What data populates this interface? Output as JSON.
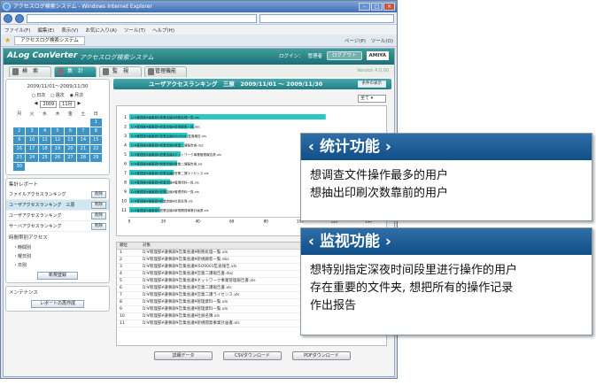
{
  "browser": {
    "title": "アクセスログ検索システム - Windows Internet Explorer",
    "menu": [
      "ファイル(F)",
      "編集(E)",
      "表示(V)",
      "お気に入り(A)",
      "ツール(T)",
      "ヘルプ(H)"
    ],
    "tab": "アクセスログ検索システム",
    "tools": [
      "ページ(P)",
      "ツール(O)"
    ]
  },
  "app": {
    "logo": "ALog ConVerter",
    "subtitle": "アクセスログ検索システム",
    "login_label": "ログイン：",
    "user": "管理者",
    "logout": "ログアウト",
    "vendor": "AMIYA",
    "version": "Version 4.0.00",
    "tabs": [
      "検　索",
      "集　計",
      "監　視",
      "管理機能"
    ]
  },
  "sidebar": {
    "date_range": "2009/11/01〜2009/11/30",
    "radios": [
      "日次",
      "週次",
      "月次"
    ],
    "year": "2009",
    "month": "11月",
    "weekdays": [
      "月",
      "火",
      "水",
      "木",
      "金",
      "土",
      "日"
    ],
    "days": [
      "",
      "",
      "",
      "",
      "",
      "",
      "1",
      "2",
      "3",
      "4",
      "5",
      "6",
      "7",
      "8",
      "9",
      "10",
      "11",
      "12",
      "13",
      "14",
      "15",
      "16",
      "17",
      "18",
      "19",
      "20",
      "21",
      "22",
      "23",
      "24",
      "25",
      "26",
      "27",
      "28",
      "29",
      "30"
    ],
    "report_title": "集計レポート",
    "reports": [
      {
        "label": "ファイルアクセスランキング",
        "btn": "削除"
      },
      {
        "label": "ユーザアクセスランキング　三原",
        "btn": "削除"
      },
      {
        "label": "ユーザアクセスランキング",
        "btn": "削除"
      },
      {
        "label": "サーバアクセスランキング",
        "btn": "削除"
      }
    ],
    "time_title": "時間帯別アクセス",
    "time_items": [
      "・時間別",
      "・曜日別",
      "・日別"
    ],
    "new_btn": "新規登録",
    "maint_title": "メンテナンス",
    "maint_btn": "レポートの再作成"
  },
  "main": {
    "title": "ユーザアクセスランキング　三原　2009/11/01 〜 2009/11/30",
    "cond_btn": "条件の表示",
    "top_select": "全て",
    "col_rank": "順位",
    "col_target": "対象",
    "rows": [
      "D:¥管理部¥議事録¥営業会議¥税務処理一覧.xls",
      "D:¥管理部¥議事録¥営業会議¥新規顧客一覧.doc",
      "D:¥管理部¥議事録¥営業会議¥ISO9001監査報告.xls",
      "D:¥管理部¥議事録¥営業会議¥営業二課報告書.doc",
      "D:¥管理部¥議事録¥営業会議¥ネットワーク事業管理報告書.xls",
      "D:¥管理部¥議事録¥営業会議¥営業二課報告書.xls",
      "D:¥管理部¥議事録¥営業会議¥営業二課ライセンス.xls",
      "D:¥管理部¥議事録¥営業会議¥管理資料一覧.xls",
      "D:¥管理部¥議事録¥営業会議¥管理資料一覧.xls",
      "D:¥管理部¥議事録¥営業会議¥社員名簿.xls",
      "D:¥管理部¥議事録¥営業会議¥新規開発事業計画書.xls"
    ],
    "buttons": [
      "詳細データ",
      "CSVダウンロード",
      "PDFダウンロード"
    ]
  },
  "chart_data": {
    "type": "bar",
    "categories": [
      "1",
      "2",
      "3",
      "4",
      "5",
      "6",
      "7",
      "8",
      "9",
      "10",
      "11"
    ],
    "values": [
      115,
      38,
      34,
      32,
      30,
      28,
      26,
      24,
      22,
      20,
      18
    ],
    "xlim": [
      0,
      140
    ],
    "xticks": [
      "0",
      "20",
      "40",
      "60",
      "80",
      "100",
      "120",
      "140"
    ],
    "color": "#2cc7c4"
  },
  "callouts": [
    {
      "title": "统计功能",
      "lines": [
        "想调查文件操作最多的用户",
        "想抽出印刷次数靠前的用户"
      ]
    },
    {
      "title": "监视功能",
      "lines": [
        "想特别指定深夜时间段里进行操作的用户",
        "存在重要的文件夹, 想把所有的操作记录",
        "作出报告"
      ]
    }
  ]
}
